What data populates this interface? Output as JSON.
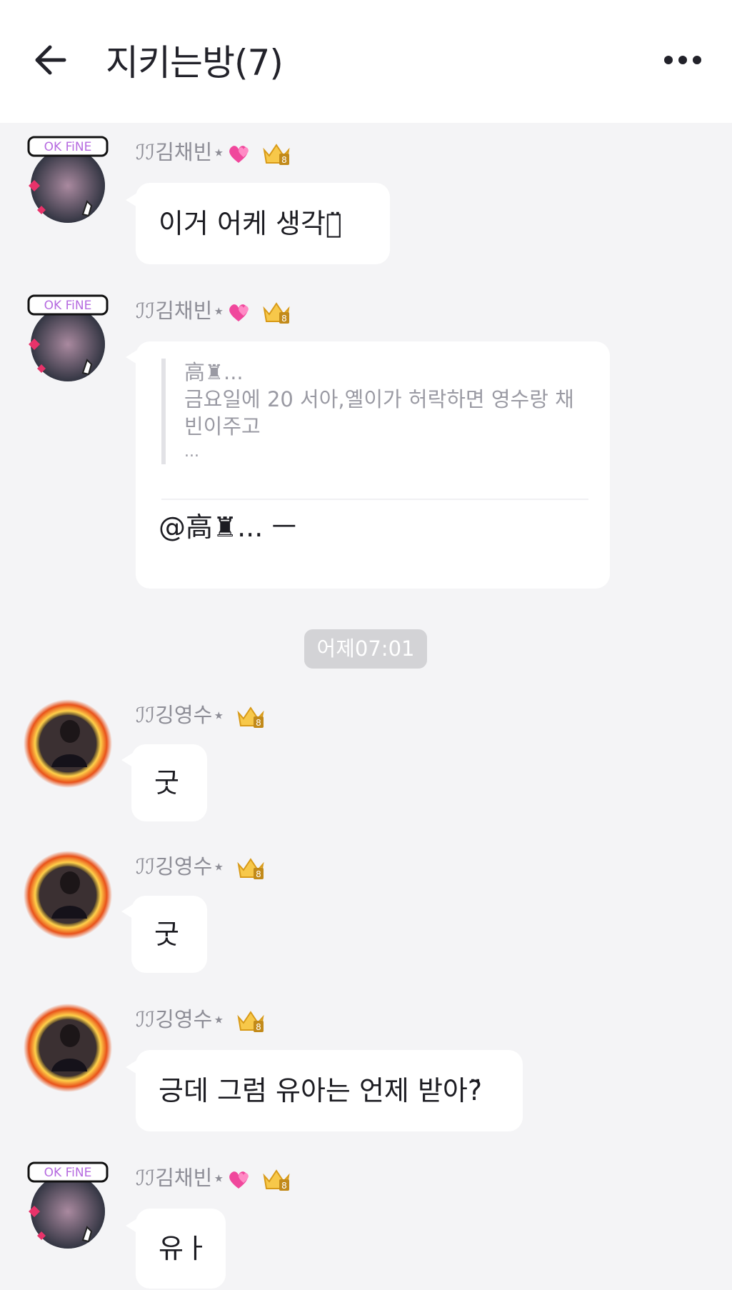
{
  "header": {
    "title": "지키는방(7)",
    "back_icon": "arrow-left-icon",
    "more_icon": "more-horizontal-icon"
  },
  "colors": {
    "background": "#f4f4f6",
    "bubble": "#ffffff",
    "timestamp_bg": "#d3d3d6",
    "sender_text": "#8d8d96"
  },
  "messages": [
    {
      "sender_prefix": "ℐℐ",
      "sender_name": "김채빈⋆",
      "text": "이거 어케 생각해̈"
    },
    {
      "sender_prefix": "ℐℐ",
      "sender_name": "김채빈⋆",
      "quote_author": "高♜...",
      "quote_text": "금요일에 20 서아,옐이가 허락하면 영수랑 채빈이주고",
      "quote_more": "...",
      "text": "@高♜... ㅡ"
    },
    {
      "sender_prefix": "ℐℐ",
      "sender_name": "깅영수⋆",
      "text": "굿"
    },
    {
      "sender_prefix": "ℐℐ",
      "sender_name": "깅영수⋆",
      "text": "굿"
    },
    {
      "sender_prefix": "ℐℐ",
      "sender_name": "깅영수⋆",
      "text": "긍데 그럼 유아는 언제 받아?̈"
    },
    {
      "sender_prefix": "ℐℐ",
      "sender_name": "김채빈⋆",
      "text": "유ㅏ"
    }
  ],
  "timestamp": "어제07:01",
  "avatars": {
    "chaebin": {
      "tag": "OK FiNE"
    }
  }
}
